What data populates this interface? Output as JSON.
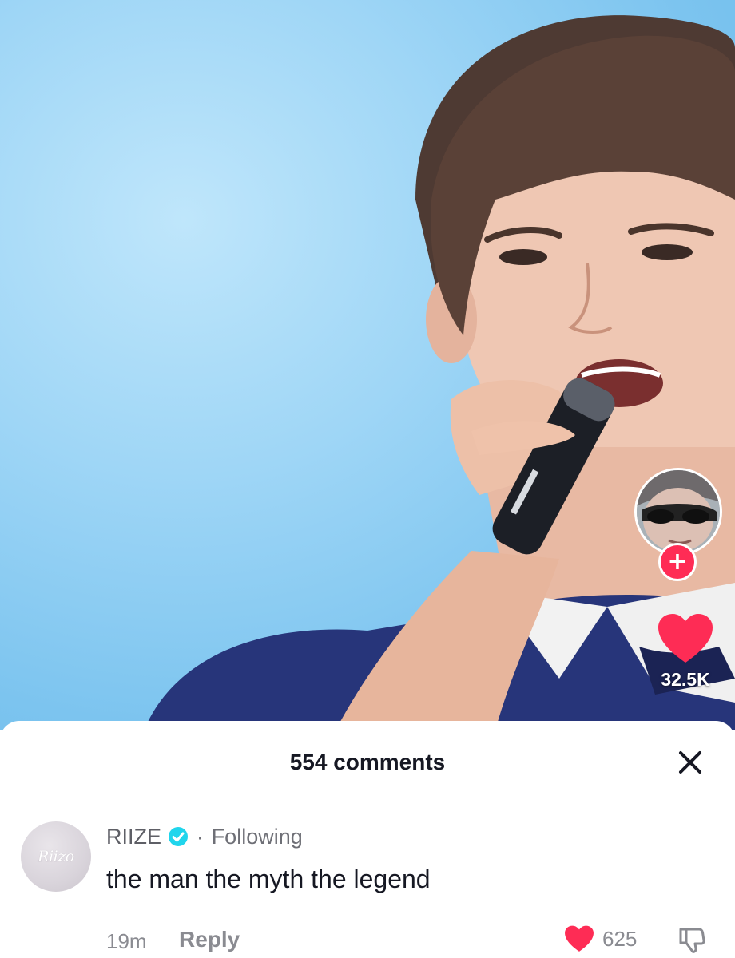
{
  "rail": {
    "like_count": "32.5K",
    "follow_symbol": "+"
  },
  "comments_sheet": {
    "title": "554 comments",
    "comment": {
      "username": "RIIZE",
      "avatar_logo": "Riizo",
      "separator": "·",
      "following_label": "Following",
      "text": "the man the myth the legend",
      "time": "19m",
      "reply_label": "Reply",
      "like_count": "625"
    }
  },
  "colors": {
    "like_red": "#fe2c55",
    "verified_blue": "#20d5ec",
    "sky": "#8ecff4"
  },
  "icons": {
    "close": "close-icon",
    "heart": "heart-icon",
    "verified": "verified-badge-icon",
    "dislike": "thumbs-down-icon",
    "follow": "plus-icon"
  }
}
